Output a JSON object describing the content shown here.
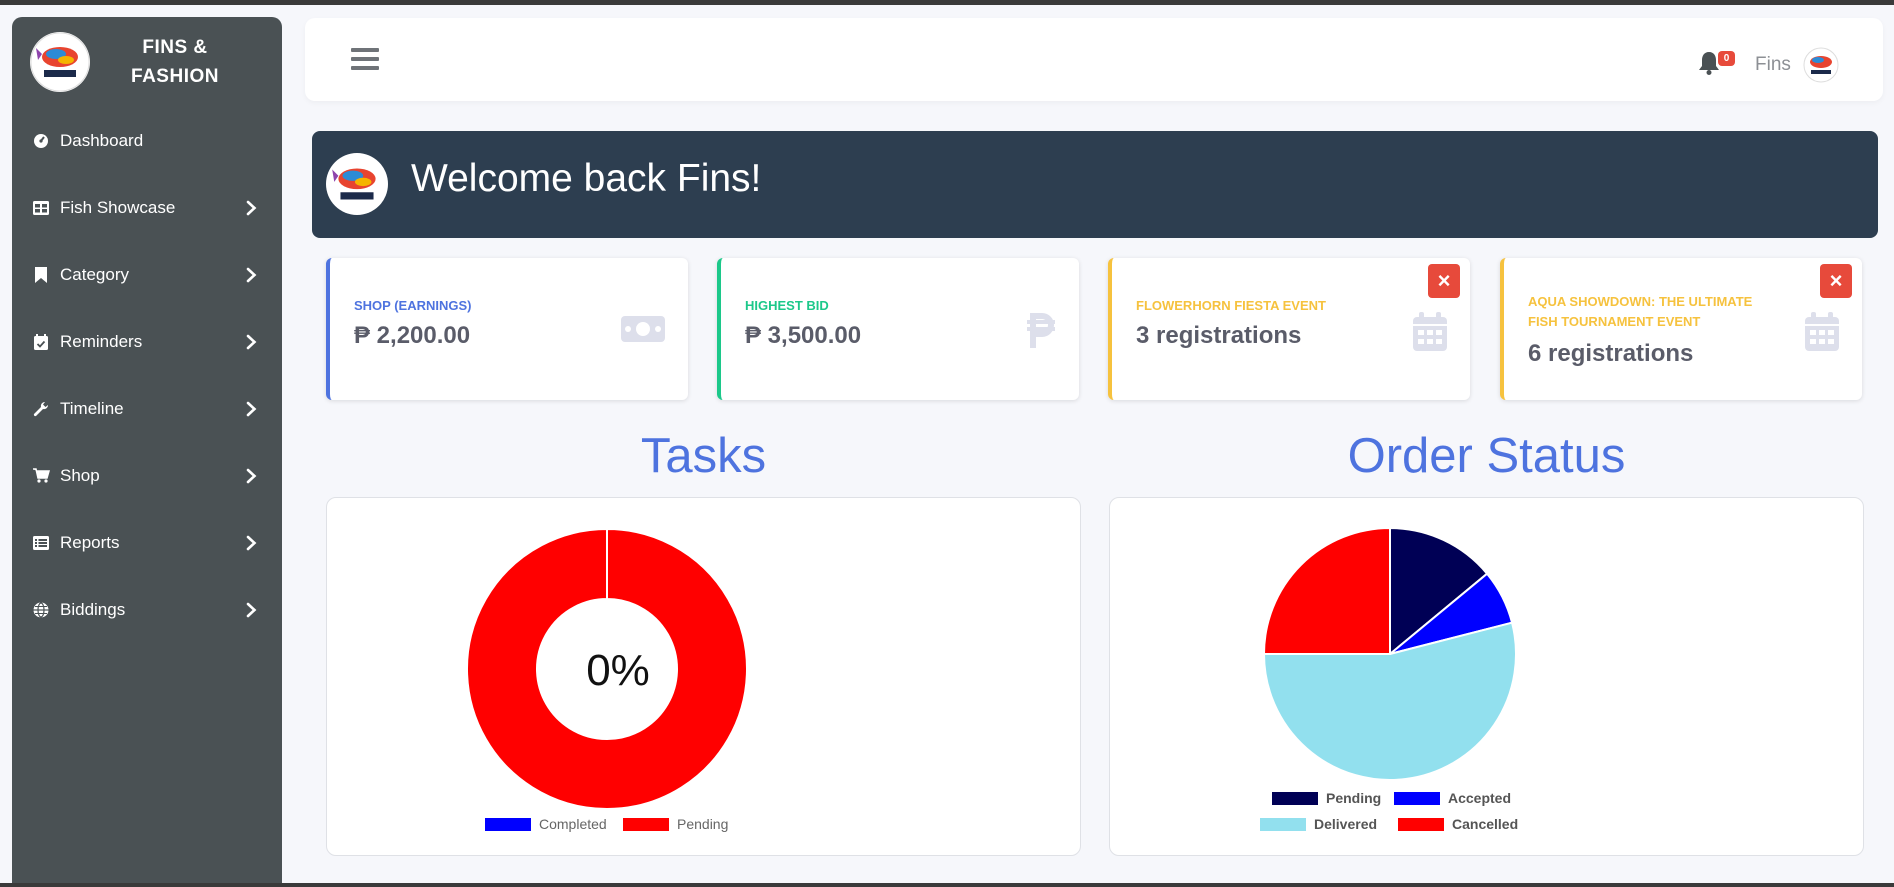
{
  "brand": {
    "line1": "FINS &",
    "line2": "FASHION",
    "logo_icon": "fins-fashion-logo"
  },
  "sidebar": {
    "items": [
      {
        "label": "Dashboard",
        "icon": "dashboard-gauge-icon",
        "has_chevron": false
      },
      {
        "label": "Fish Showcase",
        "icon": "grid-table-icon",
        "has_chevron": true
      },
      {
        "label": "Category",
        "icon": "bookmark-icon",
        "has_chevron": true
      },
      {
        "label": "Reminders",
        "icon": "calendar-check-icon",
        "has_chevron": true
      },
      {
        "label": "Timeline",
        "icon": "wrench-icon",
        "has_chevron": true
      },
      {
        "label": "Shop",
        "icon": "cart-icon",
        "has_chevron": true
      },
      {
        "label": "Reports",
        "icon": "list-icon",
        "has_chevron": true
      },
      {
        "label": "Biddings",
        "icon": "globe-icon",
        "has_chevron": true
      }
    ]
  },
  "header": {
    "notification_count": "0",
    "user_name": "Fins"
  },
  "welcome": {
    "text": "Welcome back Fins!"
  },
  "cards": [
    {
      "title": "SHOP (EARNINGS)",
      "value": "₱ 2,200.00",
      "color": "#4e73df",
      "icon": "money-bill-icon",
      "closable": false
    },
    {
      "title": "HIGHEST BID",
      "value": "₱ 3,500.00",
      "color": "#1cc88a",
      "icon": "peso-sign-icon",
      "closable": false
    },
    {
      "title": "FLOWERHORN FIESTA EVENT",
      "value": "3 registrations",
      "color": "#f6c23e",
      "icon": "calendar-icon",
      "closable": true
    },
    {
      "title": "AQUA SHOWDOWN: THE ULTIMATE FISH TOURNAMENT EVENT",
      "value": "6 registrations",
      "color": "#f6c23e",
      "icon": "calendar-icon",
      "closable": true
    }
  ],
  "tasks": {
    "title": "Tasks",
    "center_label": "0%"
  },
  "orders": {
    "title": "Order Status"
  },
  "chart_data": [
    {
      "type": "pie",
      "variant": "doughnut",
      "categories": [
        "Completed",
        "Pending"
      ],
      "values": [
        0,
        100
      ],
      "colors": [
        "#0000ff",
        "#ff0000"
      ],
      "legend": "bottom"
    },
    {
      "type": "pie",
      "categories": [
        "Pending",
        "Accepted",
        "Delivered",
        "Cancelled"
      ],
      "values": [
        14,
        7,
        54,
        25
      ],
      "colors": [
        "#000055",
        "#0000ff",
        "#92e0ee",
        "#ff0000"
      ],
      "legend": "bottom"
    }
  ]
}
